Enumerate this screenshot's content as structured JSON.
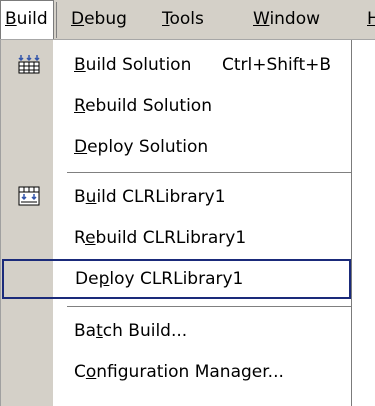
{
  "menubar": {
    "items": [
      {
        "pre": "",
        "mn": "B",
        "post": "uild"
      },
      {
        "pre": "",
        "mn": "D",
        "post": "ebug"
      },
      {
        "pre": "",
        "mn": "T",
        "post": "ools"
      },
      {
        "pre": "",
        "mn": "W",
        "post": "indow"
      },
      {
        "pre": "",
        "mn": "H",
        "post": ""
      }
    ]
  },
  "menu": {
    "items": [
      {
        "pre": "",
        "mn": "B",
        "post": "uild Solution",
        "shortcut": "Ctrl+Shift+B",
        "icon": "build-solution-icon"
      },
      {
        "pre": "",
        "mn": "R",
        "post": "ebuild Solution"
      },
      {
        "pre": "",
        "mn": "D",
        "post": "eploy Solution"
      },
      {
        "pre": "B",
        "mn": "u",
        "post": "ild CLRLibrary1",
        "icon": "build-project-icon"
      },
      {
        "pre": "R",
        "mn": "e",
        "post": "build CLRLibrary1"
      },
      {
        "pre": "De",
        "mn": "p",
        "post": "loy CLRLibrary1"
      },
      {
        "pre": "Ba",
        "mn": "t",
        "post": "ch Build..."
      },
      {
        "pre": "C",
        "mn": "o",
        "post": "nfiguration Manager..."
      }
    ]
  },
  "colors": {
    "menubar_bg": "#d4d0c8",
    "highlight_border": "#1a2a7a",
    "icon_blue": "#3355aa"
  }
}
